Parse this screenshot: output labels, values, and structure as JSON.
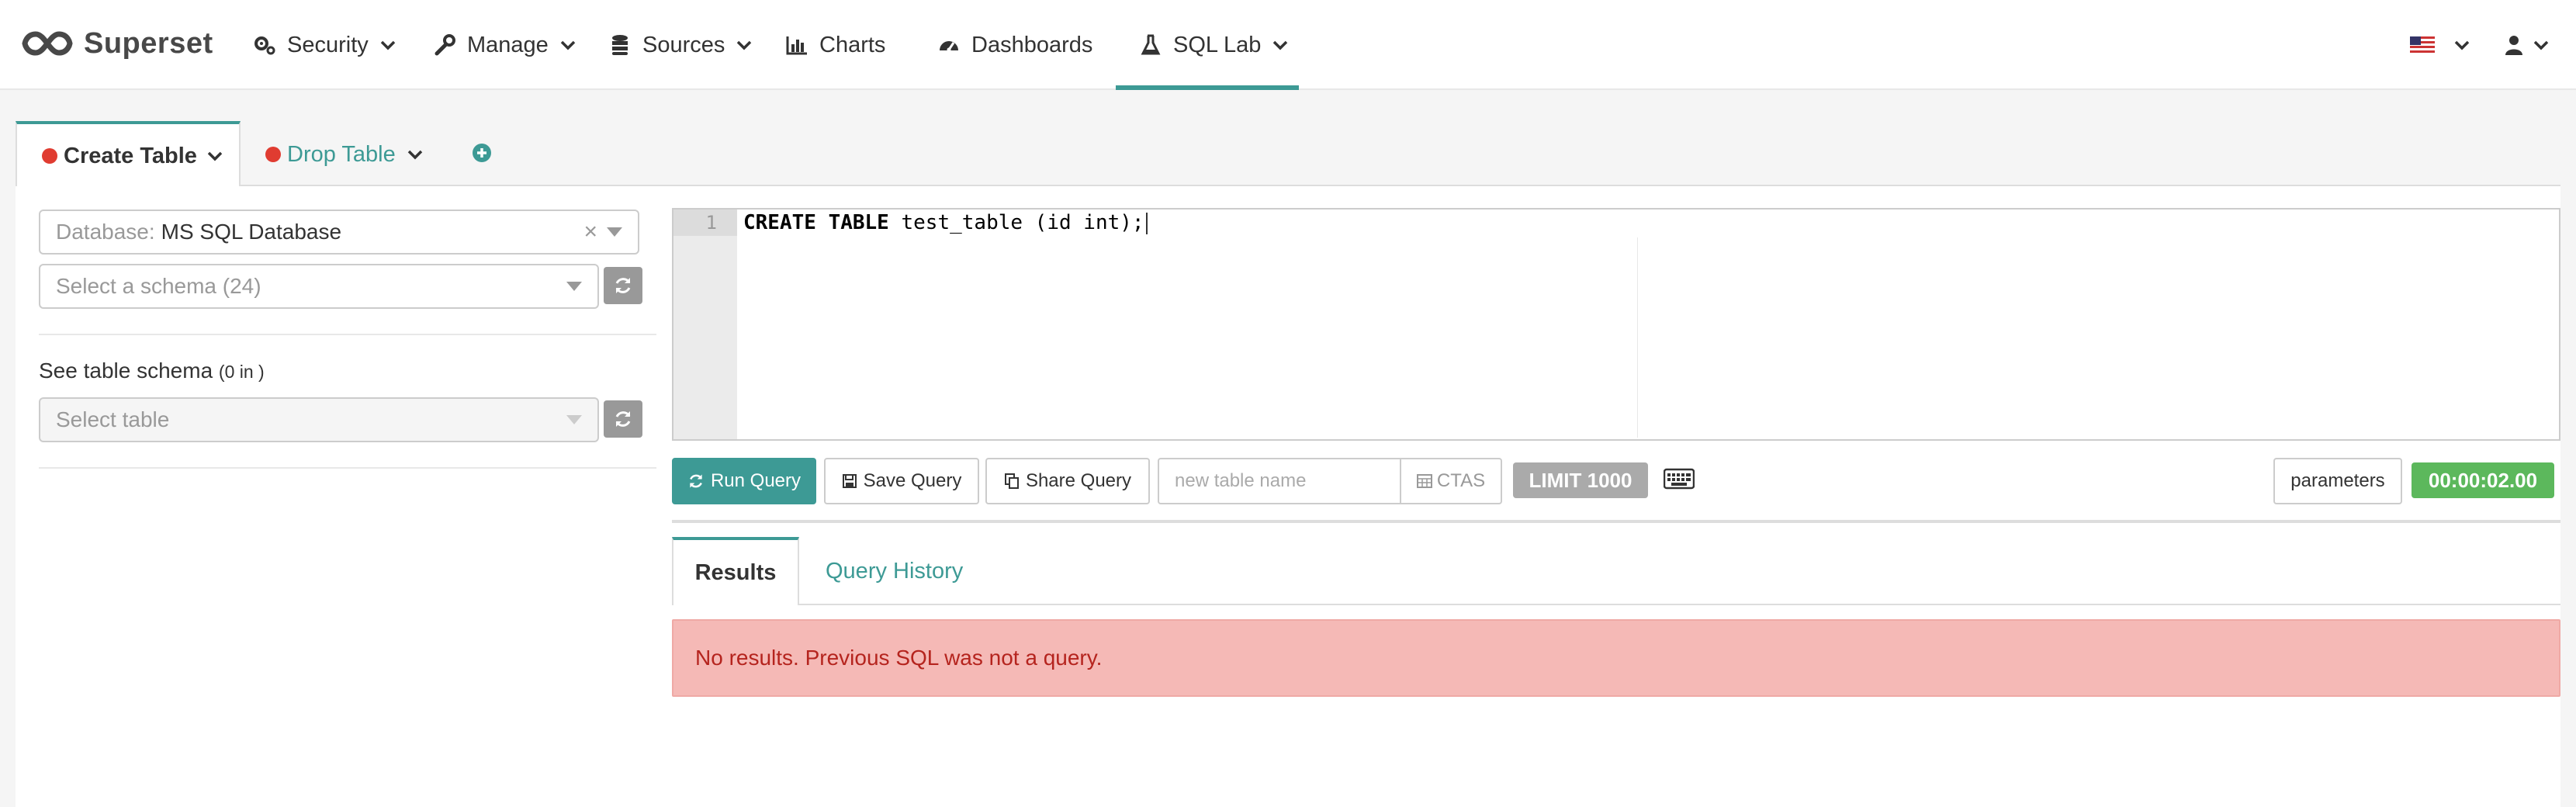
{
  "brand": {
    "name": "Superset"
  },
  "nav": {
    "items": [
      {
        "label": "Security",
        "icon": "cogs-icon"
      },
      {
        "label": "Manage",
        "icon": "wrench-icon"
      },
      {
        "label": "Sources",
        "icon": "database-icon"
      },
      {
        "label": "Charts",
        "icon": "bar-chart-icon"
      },
      {
        "label": "Dashboards",
        "icon": "dashboard-icon"
      },
      {
        "label": "SQL Lab",
        "icon": "flask-icon"
      }
    ],
    "active": "SQL Lab",
    "language_icon": "us-flag-icon",
    "user_icon": "user-icon"
  },
  "query_tabs": [
    {
      "label": "Create Table",
      "status": "error"
    },
    {
      "label": "Drop Table",
      "status": "error"
    }
  ],
  "left_panel": {
    "database_prefix": "Database:",
    "database_value": "MS SQL Database",
    "schema_placeholder": "Select a schema (24)",
    "see_schema_label": "See table schema",
    "see_schema_count": "(0 in )",
    "table_placeholder": "Select table"
  },
  "editor": {
    "line_number": "1",
    "kw1": "CREATE TABLE",
    "code_rest": " test_table (id int);"
  },
  "toolbar": {
    "run_label": "Run Query",
    "save_label": "Save Query",
    "share_label": "Share Query",
    "new_table_placeholder": "new table name",
    "ctas_label": "CTAS",
    "limit_label": "LIMIT 1000",
    "params_label": "parameters",
    "timer": "00:00:02.00"
  },
  "results": {
    "tabs": [
      "Results",
      "Query History"
    ],
    "message": "No results. Previous SQL was not a query."
  },
  "colors": {
    "accent": "#3d9a95",
    "error_dot": "#e03c31",
    "alert_bg": "#f5b9b6",
    "timer_bg": "#5cb85c"
  }
}
